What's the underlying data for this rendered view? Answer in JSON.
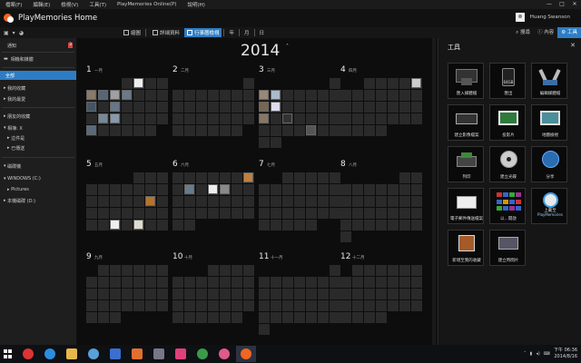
{
  "menu": {
    "items": [
      "檔案(F)",
      "編輯(E)",
      "檢視(V)",
      "工具(T)",
      "PlayMemories Online(P)",
      "說明(H)"
    ],
    "window_controls": [
      "—",
      "□",
      "✕"
    ]
  },
  "app": {
    "title": "PlayMemories Home"
  },
  "user": {
    "name": "Huang Swanson"
  },
  "toolbar": {
    "views": [
      "縮圖",
      "詳細資料",
      "行事曆檢視"
    ],
    "date_tabs": [
      "年",
      "月",
      "日"
    ],
    "right": [
      "搜尋",
      "內容",
      "工具"
    ]
  },
  "sidebar": {
    "notifications": {
      "label": "通知",
      "count": "3"
    },
    "camera": "相機和媒體",
    "items": [
      "全部",
      "我的收藏",
      "我的最愛",
      "朋友的收藏",
      "相簿: X",
      "這件是",
      "已傳送",
      "磁碟機",
      "WINDOWS (C:)",
      "Pictures",
      "本機磁碟 (D:)"
    ]
  },
  "calendar": {
    "year": "2014",
    "toggle": "˄",
    "months": [
      {
        "num": "1",
        "name": "一月"
      },
      {
        "num": "2",
        "name": "二月"
      },
      {
        "num": "3",
        "name": "三月"
      },
      {
        "num": "4",
        "name": "四月"
      },
      {
        "num": "5",
        "name": "五月"
      },
      {
        "num": "6",
        "name": "六月"
      },
      {
        "num": "7",
        "name": "七月"
      },
      {
        "num": "8",
        "name": "八月"
      },
      {
        "num": "9",
        "name": "九月"
      },
      {
        "num": "10",
        "name": "十月"
      },
      {
        "num": "11",
        "name": "十一月"
      },
      {
        "num": "12",
        "name": "十二月"
      }
    ]
  },
  "tools": {
    "title": "工具",
    "close": "✕",
    "items": [
      {
        "label": "匯入媒體檔"
      },
      {
        "label": "匯出",
        "sub": "64GB"
      },
      {
        "label": "編輯媒體檔"
      },
      {
        "label": "建立影像檔案"
      },
      {
        "label": "投影片"
      },
      {
        "label": "地圖檢視"
      },
      {
        "label": "列印"
      },
      {
        "label": "建立光碟"
      },
      {
        "label": "分享"
      },
      {
        "label": "電子郵件傳送檔案"
      },
      {
        "label": "以...開啟"
      },
      {
        "label": "上載至",
        "sub": "PlayMemories"
      },
      {
        "label": "新增至我的收藏"
      },
      {
        "label": "建立時間片"
      }
    ]
  },
  "taskbar": {
    "clock_time": "下午 06:36",
    "clock_date": "2014/8/16"
  }
}
